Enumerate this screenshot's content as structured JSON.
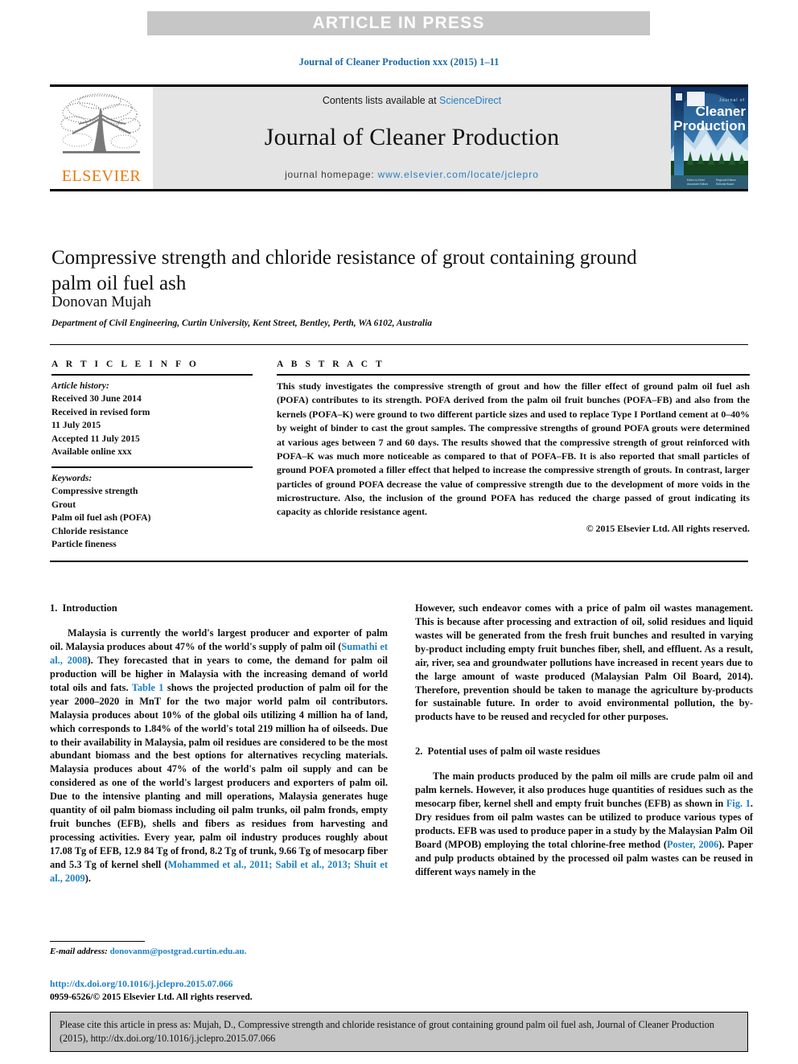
{
  "banner": {
    "text": "ARTICLE IN PRESS"
  },
  "journal_ref": "Journal of Cleaner Production xxx (2015) 1–11",
  "masthead": {
    "publisher": "ELSEVIER",
    "contents_prefix": "Contents lists available at ",
    "contents_link": "ScienceDirect",
    "journal_name": "Journal of Cleaner Production",
    "homepage_label": "journal homepage: ",
    "homepage_url": "www.elsevier.com/locate/jclepro",
    "cover_title_small": "Journal of",
    "cover_title_line1": "Cleaner",
    "cover_title_line2": "Production"
  },
  "article": {
    "title": "Compressive strength and chloride resistance of grout containing ground palm oil fuel ash",
    "author": "Donovan Mujah",
    "affiliation": "Department of Civil Engineering, Curtin University, Kent Street, Bentley, Perth, WA 6102, Australia"
  },
  "info": {
    "heading": "A R T I C L E   I N F O",
    "history_label": "Article history:",
    "history": [
      "Received 30 June 2014",
      "Received in revised form",
      "11 July 2015",
      "Accepted 11 July 2015",
      "Available online xxx"
    ],
    "keywords_label": "Keywords:",
    "keywords": [
      "Compressive strength",
      "Grout",
      "Palm oil fuel ash (POFA)",
      "Chloride resistance",
      "Particle fineness"
    ]
  },
  "abstract": {
    "heading": "A B S T R A C T",
    "text": "This study investigates the compressive strength of grout and how the filler effect of ground palm oil fuel ash (POFA) contributes to its strength. POFA derived from the palm oil fruit bunches (POFA–FB) and also from the kernels (POFA–K) were ground to two different particle sizes and used to replace Type I Portland cement at 0–40% by weight of binder to cast the grout samples. The compressive strengths of ground POFA grouts were determined at various ages between 7 and 60 days. The results showed that the compressive strength of grout reinforced with POFA–K was much more noticeable as compared to that of POFA–FB. It is also reported that small particles of ground POFA promoted a filler effect that helped to increase the compressive strength of grouts. In contrast, larger particles of ground POFA decrease the value of compressive strength due to the development of more voids in the microstructure. Also, the inclusion of the ground POFA has reduced the charge passed of grout indicating its capacity as chloride resistance agent.",
    "copyright": "© 2015 Elsevier Ltd. All rights reserved."
  },
  "sections": {
    "intro": {
      "number": "1.",
      "title": "Introduction",
      "para1_a": "Malaysia is currently the world's largest producer and exporter of palm oil. Malaysia produces about 47% of the world's supply of palm oil (",
      "para1_ref1": "Sumathi et al., 2008",
      "para1_b": "). They forecasted that in years to come, the demand for palm oil production will be higher in Malaysia with the increasing demand of world total oils and fats. ",
      "para1_ref2": "Table 1",
      "para1_c": " shows the projected production of palm oil for the year 2000–2020 in MnT for the two major world palm oil contributors. Malaysia produces about 10% of the global oils utilizing 4 million ha of land, which corresponds to 1.84% of the world's total 219 million ha of oilseeds. Due to their availability in Malaysia, palm oil residues are considered to be the most abundant biomass and the best options for alternatives recycling materials. Malaysia produces about 47% of the world's palm oil supply and can be considered as one of the world's largest producers and exporters of palm oil. Due to the intensive planting and mill operations, Malaysia generates huge quantity of oil palm biomass including oil palm trunks, oil palm fronds, empty fruit bunches (EFB), shells and fibers as residues from harvesting and processing activities. Every year, palm oil industry produces roughly about 17.08 Tg of EFB, 12.9 84 Tg of frond, 8.2 Tg of trunk, 9.66 Tg of mesocarp fiber and 5.3 Tg of kernel shell (",
      "para1_ref3": "Mohammed et al., 2011; Sabil et al., 2013; Shuit et al., 2009",
      "para1_d": ").",
      "para2_a": "However, such endeavor comes with a price of palm oil wastes management. This is because after processing and extraction of oil, solid residues and liquid wastes will be generated from the fresh fruit bunches and resulted in varying by-product including empty fruit bunches fiber, shell, and effluent. As a result, air, river, sea and groundwater pollutions have increased in recent years due to the large amount of waste produced (Malaysian Palm Oil Board, 2014). Therefore, prevention should be taken to manage the agriculture by-products for sustainable future. In order to avoid environmental pollution, the by-products have to be reused and recycled for other purposes."
    },
    "potential": {
      "number": "2.",
      "title": "Potential uses of palm oil waste residues",
      "para1_a": "The main products produced by the palm oil mills are crude palm oil and palm kernels. However, it also produces huge quantities of residues such as the mesocarp fiber, kernel shell and empty fruit bunches (EFB) as shown in ",
      "para1_ref1": "Fig. 1",
      "para1_b": ". Dry residues from oil palm wastes can be utilized to produce various types of products. EFB was used to produce paper in a study by the Malaysian Palm Oil Board (MPOB) employing the total chlorine-free method (",
      "para1_ref2": "Poster, 2006",
      "para1_c": "). Paper and pulp products obtained by the processed oil palm wastes can be reused in different ways namely in the"
    }
  },
  "footnote": {
    "label": "E-mail address:",
    "email": "donovanm@postgrad.curtin.edu.au."
  },
  "doi": {
    "url": "http://dx.doi.org/10.1016/j.jclepro.2015.07.066",
    "issn_line": "0959-6526/© 2015 Elsevier Ltd. All rights reserved."
  },
  "citation": {
    "text": "Please cite this article in press as: Mujah, D., Compressive strength and chloride resistance of grout containing ground palm oil fuel ash, Journal of Cleaner Production (2015), http://dx.doi.org/10.1016/j.jclepro.2015.07.066"
  },
  "colors": {
    "link": "#1b7fc4",
    "banner_bg": "#c6c6c6",
    "elsevier_orange": "#e87b10"
  }
}
